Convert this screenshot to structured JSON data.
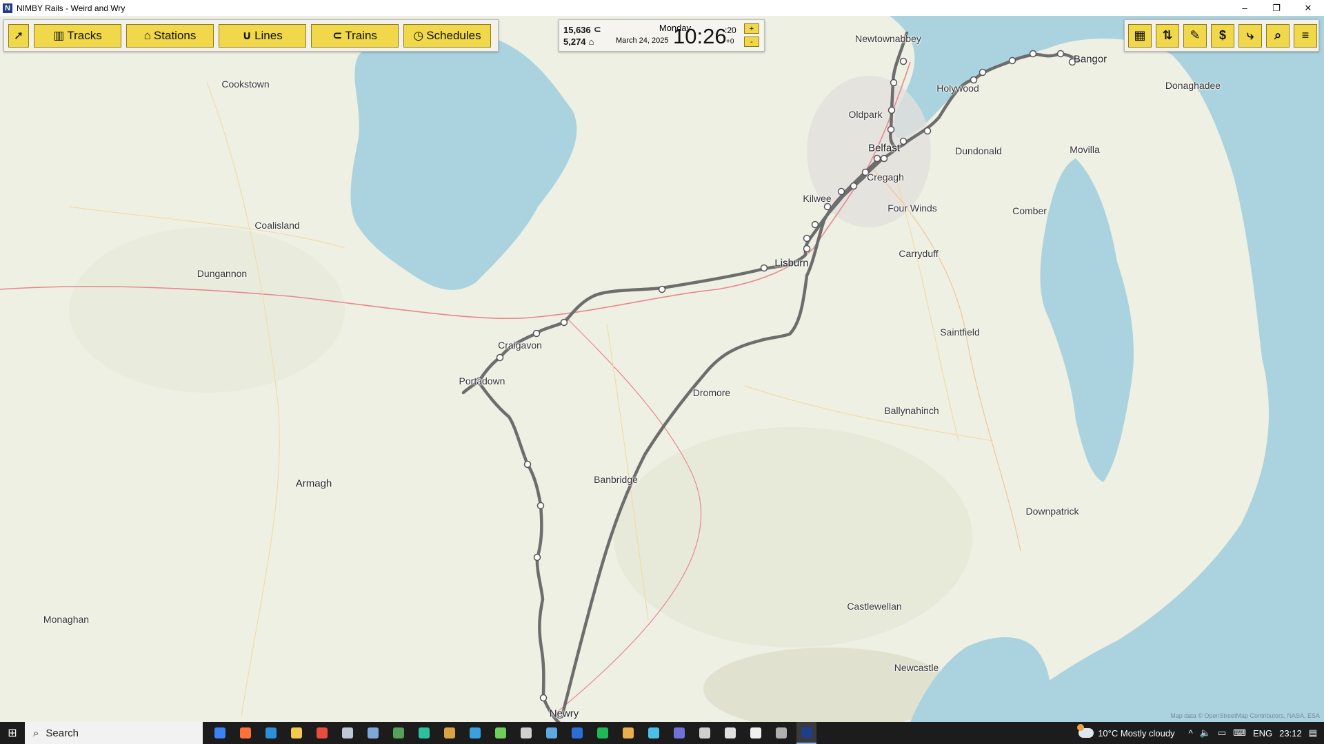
{
  "window": {
    "title": "NIMBY Rails - Weird and Wry",
    "minimize": "–",
    "restore": "❐",
    "close": "✕"
  },
  "toolbar": {
    "select_icon": "cursor-icon",
    "buttons": [
      {
        "label": "Tracks",
        "icon": "tracks-icon"
      },
      {
        "label": "Stations",
        "icon": "station-icon"
      },
      {
        "label": "Lines",
        "icon": "lines-icon"
      },
      {
        "label": "Trains",
        "icon": "train-icon"
      },
      {
        "label": "Schedules",
        "icon": "stopwatch-icon"
      }
    ]
  },
  "status": {
    "trains_count": "15,636",
    "passengers_count": "5,274",
    "day": "Monday",
    "date": "March 24, 2025",
    "time": "10:26",
    "seconds": ":20",
    "offset": "+0",
    "speed_up": "+",
    "speed_down": "-"
  },
  "right_toolbar": {
    "buttons": [
      {
        "name": "map-overlay-button",
        "icon": "map-icon",
        "glyph": "▦"
      },
      {
        "name": "sort-button",
        "icon": "sort-icon",
        "glyph": "⇅"
      },
      {
        "name": "tickets-button",
        "icon": "ticket-icon",
        "glyph": "✎"
      },
      {
        "name": "finance-button",
        "icon": "dollar-icon",
        "glyph": "$"
      },
      {
        "name": "sign-button",
        "icon": "signpost-icon",
        "glyph": "⤷"
      },
      {
        "name": "search-button",
        "icon": "search-icon",
        "glyph": "⌕"
      },
      {
        "name": "menu-button",
        "icon": "menu-icon",
        "glyph": "≡"
      }
    ]
  },
  "map": {
    "places": [
      "Newtownabbey",
      "Cookstown",
      "Bangor",
      "Holywood",
      "Donaghadee",
      "Oldpark",
      "Belfast",
      "Dundonald",
      "Movilla",
      "Cregagh",
      "Kilwee",
      "Four Winds",
      "Comber",
      "Coalisland",
      "Dungannon",
      "Lisburn",
      "Carryduff",
      "Craigavon",
      "Portadown",
      "Saintfield",
      "Dromore",
      "Ballynahinch",
      "Armagh",
      "Banbridge",
      "Downpatrick",
      "Monaghan",
      "Castlewellan",
      "Newcastle",
      "Newry"
    ],
    "attribution": "Map data © OpenStreetMap Contributors, NASA, ESA"
  },
  "taskbar": {
    "search_placeholder": "Search",
    "weather": "10°C  Mostly cloudy",
    "language": "ENG",
    "clock": "23:12",
    "apps": [
      {
        "name": "file-explorer-app",
        "color": "#3b82f6"
      },
      {
        "name": "firefox-app",
        "color": "#ff7139"
      },
      {
        "name": "vscode-app",
        "color": "#2b8fd9"
      },
      {
        "name": "folder-app",
        "color": "#f2c94c"
      },
      {
        "name": "app-red",
        "color": "#e74c3c"
      },
      {
        "name": "steam-app",
        "color": "#c0c8d8"
      },
      {
        "name": "notes-app",
        "color": "#7fa8d8"
      },
      {
        "name": "app-green",
        "color": "#56a05a"
      },
      {
        "name": "edge-app",
        "color": "#2dbfa0"
      },
      {
        "name": "game-app",
        "color": "#d9a441"
      },
      {
        "name": "app-blue",
        "color": "#3aa0e0"
      },
      {
        "name": "app-multi",
        "color": "#6fcf5a"
      },
      {
        "name": "app-gray",
        "color": "#d0d0d0"
      },
      {
        "name": "steam-client-app",
        "color": "#5ea9e0"
      },
      {
        "name": "outlook-app",
        "color": "#2a6fd6"
      },
      {
        "name": "spotify-app",
        "color": "#1db954"
      },
      {
        "name": "app-yellow",
        "color": "#e8b04a"
      },
      {
        "name": "app-cyan",
        "color": "#4ac0e8"
      },
      {
        "name": "app-teams",
        "color": "#6f73d8"
      },
      {
        "name": "settings-app",
        "color": "#cfcfcf"
      },
      {
        "name": "app-dark",
        "color": "#e0e0e0"
      },
      {
        "name": "app-white",
        "color": "#f0f0f0"
      },
      {
        "name": "app-usb",
        "color": "#b0b0b0"
      },
      {
        "name": "nimby-app",
        "color": "#1f3d8a"
      }
    ]
  }
}
